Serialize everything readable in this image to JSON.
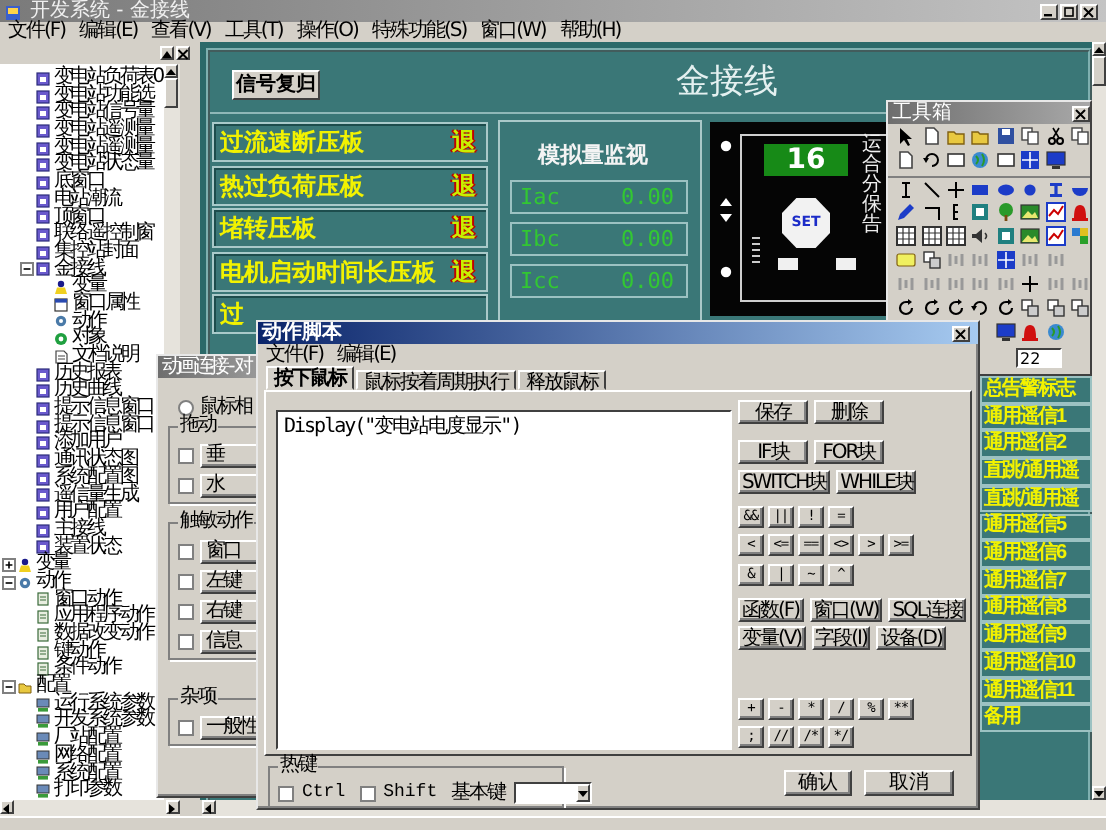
{
  "window": {
    "title": "开发系统 - 金接线"
  },
  "menu": [
    "文件(F)",
    "编辑(E)",
    "查看(V)",
    "工具(T)",
    "操作(O)",
    "特殊功能(S)",
    "窗口(W)",
    "帮助(H)"
  ],
  "tree": [
    {
      "children": [
        {
          "label": "变电站负荷表0",
          "kind": "window"
        },
        {
          "label": "变电站功能选",
          "kind": "window"
        },
        {
          "label": "变电站信号量",
          "kind": "window"
        },
        {
          "label": "变电站遥测量",
          "kind": "window"
        },
        {
          "label": "变电站遥测量",
          "kind": "window"
        },
        {
          "label": "变电站状态量",
          "kind": "window"
        },
        {
          "label": "底窗口",
          "kind": "window"
        },
        {
          "label": "电站潮流",
          "kind": "window"
        },
        {
          "label": "顶窗口",
          "kind": "window"
        },
        {
          "label": "联络遥控制窗",
          "kind": "window"
        },
        {
          "label": "集控站封面",
          "kind": "window"
        },
        {
          "label": "金接线",
          "kind": "window",
          "expanded": true,
          "children": [
            {
              "label": "变量",
              "kind": "variable"
            },
            {
              "label": "窗口属性",
              "kind": "property"
            },
            {
              "label": "动作",
              "kind": "action"
            },
            {
              "label": "对象",
              "kind": "object"
            },
            {
              "label": "文档说明",
              "kind": "doc"
            }
          ]
        },
        {
          "label": "历史报表",
          "kind": "window"
        },
        {
          "label": "历史曲线",
          "kind": "window"
        },
        {
          "label": "提示信息窗口",
          "kind": "window"
        },
        {
          "label": "提示信息窗口",
          "kind": "window"
        },
        {
          "label": "添加用户",
          "kind": "window"
        },
        {
          "label": "通讯状态图",
          "kind": "window"
        },
        {
          "label": "系统配置图",
          "kind": "window"
        },
        {
          "label": "遥信量生成",
          "kind": "window"
        },
        {
          "label": "用户配置",
          "kind": "window"
        },
        {
          "label": "主接线",
          "kind": "window"
        },
        {
          "label": "装置状态",
          "kind": "window"
        }
      ]
    },
    {
      "label": "变量",
      "kind": "variable",
      "expanded": false
    },
    {
      "label": "动作",
      "kind": "action",
      "expanded": true,
      "children": [
        {
          "label": "窗口动作",
          "kind": "script"
        },
        {
          "label": "应用程序动作",
          "kind": "script"
        },
        {
          "label": "数据改变动作",
          "kind": "script"
        },
        {
          "label": "键动作",
          "kind": "script"
        },
        {
          "label": "条件动作",
          "kind": "script"
        }
      ]
    },
    {
      "label": "配置",
      "kind": "folder",
      "expanded": true,
      "children": [
        {
          "label": "运行系统参数",
          "kind": "config"
        },
        {
          "label": "开发系统参数",
          "kind": "config"
        },
        {
          "label": "厂站配置",
          "kind": "config"
        },
        {
          "label": "网络配置",
          "kind": "config"
        },
        {
          "label": "系统配置",
          "kind": "config"
        },
        {
          "label": "打印参数",
          "kind": "config"
        }
      ]
    }
  ],
  "canvas": {
    "reset_button": "信号复归",
    "title": "金接线",
    "plates": [
      {
        "label": "过流速断压板",
        "state": "退"
      },
      {
        "label": "热过负荷压板",
        "state": "退"
      },
      {
        "label": "堵转压板",
        "state": "退"
      },
      {
        "label": "电机启动时间长压板",
        "state": "退"
      },
      {
        "label": "过"
      }
    ],
    "monitor": {
      "title": "模拟量监视",
      "readings": [
        {
          "name": "Iac",
          "value": "0.00"
        },
        {
          "name": "Ibc",
          "value": "0.00"
        },
        {
          "name": "Icc",
          "value": "0.00"
        }
      ]
    },
    "device": {
      "display": "16",
      "key": "SET",
      "labels": [
        "运",
        "合",
        "分",
        "保",
        "告"
      ]
    },
    "signals": [
      "总告警标志",
      "通用遥信1",
      "通用遥信2",
      "直跳/通用遥",
      "直跳/通用遥",
      "通用遥信5",
      "通用遥信6",
      "通用遥信7",
      "通用遥信8",
      "通用遥信9",
      "通用遥信10",
      "通用遥信11",
      "备用"
    ]
  },
  "toolbox": {
    "title": "工具箱",
    "size_field": "22"
  },
  "animation_dialog": {
    "title": "动画连接 - 对",
    "radio": {
      "label": "鼠标相",
      "selected": false
    },
    "groups": [
      {
        "title": "拖动",
        "items": [
          {
            "label": "垂",
            "checked": false
          },
          {
            "label": "水",
            "checked": false
          }
        ]
      },
      {
        "title": "触敏动作",
        "items": [
          {
            "label": "窗口",
            "checked": false
          },
          {
            "label": "左键",
            "checked": false
          },
          {
            "label": "右键",
            "checked": false
          },
          {
            "label": "信息",
            "checked": false
          }
        ]
      },
      {
        "title": "杂项",
        "items": [
          {
            "label": "一般性",
            "checked": false
          }
        ]
      }
    ]
  },
  "script_dialog": {
    "title": "动作脚本",
    "menu": [
      "文件(F)",
      "编辑(E)"
    ],
    "tabs": [
      {
        "label": "按下鼠标",
        "selected": true
      },
      {
        "label": "鼠标按着周期执行",
        "selected": false
      },
      {
        "label": "释放鼠标",
        "selected": false
      }
    ],
    "code": "Display(\"变电站电度显示\")",
    "button_rows": [
      {
        "kind": "wide",
        "items": [
          "保存",
          "删除"
        ]
      },
      {
        "kind": "wide",
        "items": [
          "IF块",
          "FOR块"
        ]
      },
      {
        "kind": "wide",
        "items": [
          "SWITCH块",
          "WHILE块"
        ]
      },
      {
        "kind": "operator",
        "items": [
          "&&",
          "||",
          "!",
          "="
        ]
      },
      {
        "kind": "operator",
        "items": [
          "<",
          "<=",
          "==",
          "<>",
          ">",
          ">="
        ]
      },
      {
        "kind": "operator",
        "items": [
          "&",
          "|",
          "~",
          "^"
        ]
      },
      {
        "kind": "wide",
        "items": [
          "函数(F)",
          "窗口(W)",
          "SQL连接"
        ]
      },
      {
        "kind": "wide",
        "items": [
          "变量(V)",
          "字段(I)",
          "设备(D)"
        ]
      },
      {
        "kind": "operator",
        "items": [
          "+",
          "-",
          "*",
          "/",
          "%",
          "**"
        ]
      },
      {
        "kind": "operator",
        "items": [
          ";",
          "//",
          "/*",
          "*/"
        ]
      }
    ],
    "hotkey": {
      "title": "热键",
      "options": [
        {
          "label": "Ctrl",
          "checked": false
        },
        {
          "label": "Shift",
          "checked": false
        }
      ],
      "base_key_label": "基本键"
    },
    "confirm": "确认",
    "cancel": "取消"
  }
}
